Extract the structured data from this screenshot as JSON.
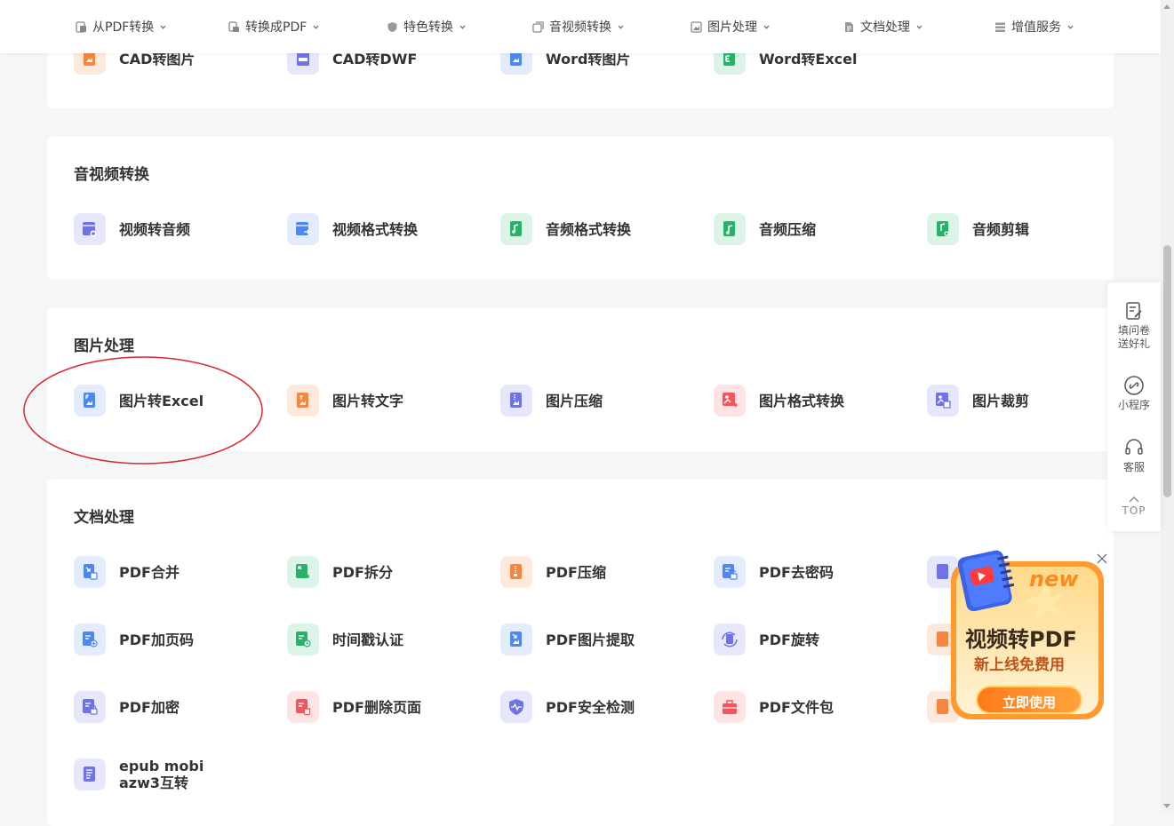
{
  "nav": {
    "items": [
      {
        "label": "从PDF转换",
        "icon": "pdf-doc-icon"
      },
      {
        "label": "转换成PDF",
        "icon": "convert-doc-icon"
      },
      {
        "label": "特色转换",
        "icon": "shield-icon"
      },
      {
        "label": "音视频转换",
        "icon": "media-icon"
      },
      {
        "label": "图片处理",
        "icon": "image-icon"
      },
      {
        "label": "文档处理",
        "icon": "document-icon"
      },
      {
        "label": "增值服务",
        "icon": "list-icon"
      }
    ]
  },
  "sections": {
    "cad": {
      "items": [
        {
          "label": "CAD转图片",
          "color": "#f7843f"
        },
        {
          "label": "CAD转DWF",
          "color": "#6f73e8"
        },
        {
          "label": "Word转图片",
          "color": "#4f87f0"
        },
        {
          "label": "Word转Excel",
          "color": "#26b368"
        }
      ]
    },
    "media": {
      "title": "音视频转换",
      "items": [
        {
          "label": "视频转音频",
          "color": "#6f73e8"
        },
        {
          "label": "视频格式转换",
          "color": "#4f87f0"
        },
        {
          "label": "音频格式转换",
          "color": "#26b368"
        },
        {
          "label": "音频压缩",
          "color": "#26b368"
        },
        {
          "label": "音频剪辑",
          "color": "#26b368"
        }
      ]
    },
    "image": {
      "title": "图片处理",
      "items": [
        {
          "label": "图片转Excel",
          "color": "#4f87f0"
        },
        {
          "label": "图片转文字",
          "color": "#f7843f"
        },
        {
          "label": "图片压缩",
          "color": "#6f73e8"
        },
        {
          "label": "图片格式转换",
          "color": "#f0575c"
        },
        {
          "label": "图片裁剪",
          "color": "#6f73e8"
        }
      ]
    },
    "doc": {
      "title": "文档处理",
      "items": [
        {
          "label": "PDF合并",
          "color": "#4f87f0"
        },
        {
          "label": "PDF拆分",
          "color": "#26b368"
        },
        {
          "label": "PDF压缩",
          "color": "#f7843f"
        },
        {
          "label": "PDF去密码",
          "color": "#4f87f0"
        },
        {
          "label": "PDF加页码",
          "color": "#4f87f0"
        },
        {
          "label": "时间戳认证",
          "color": "#26b368"
        },
        {
          "label": "PDF图片提取",
          "color": "#4f87f0"
        },
        {
          "label": "PDF旋转",
          "color": "#6f73e8"
        },
        {
          "label": "PDF加密",
          "color": "#6f73e8"
        },
        {
          "label": "PDF删除页面",
          "color": "#f0575c"
        },
        {
          "label": "PDF安全检测",
          "color": "#6f73e8"
        },
        {
          "label": "PDF文件包",
          "color": "#f0575c"
        },
        {
          "label1": "epub mobi",
          "label2": "azw3互转",
          "color": "#6f73e8"
        }
      ]
    }
  },
  "sidebar": {
    "survey1": "填问卷",
    "survey2": "送好礼",
    "miniapp": "小程序",
    "service": "客服",
    "top": "TOP"
  },
  "promo": {
    "badge": "new",
    "title": "视频转PDF",
    "subtitle": "新上线免费用",
    "button": "立即使用"
  },
  "colors": {
    "accent_orange": "#f7843f",
    "accent_blue": "#4f87f0",
    "accent_green": "#26b368",
    "accent_purple": "#6f73e8",
    "accent_red": "#f0575c",
    "annotation": "#d9262b"
  }
}
